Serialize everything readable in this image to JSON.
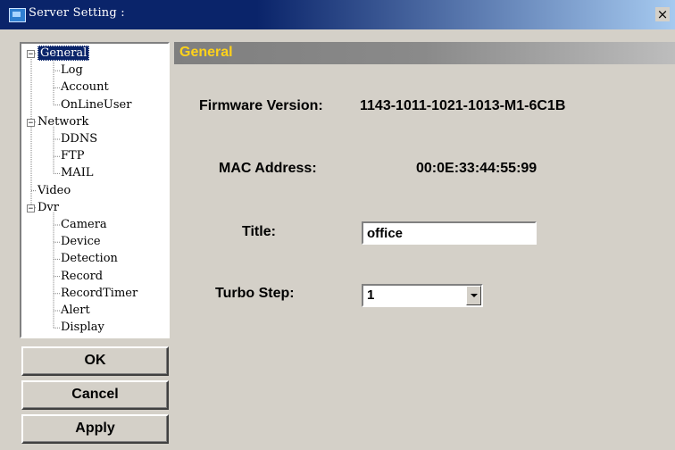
{
  "window": {
    "title": "Server Setting :",
    "close_glyph": "×"
  },
  "tree": {
    "items": [
      {
        "label": "General",
        "expander": "−",
        "level": 0,
        "selected": true
      },
      {
        "label": "Log",
        "level": 1
      },
      {
        "label": "Account",
        "level": 1
      },
      {
        "label": "OnLineUser",
        "level": 1
      },
      {
        "label": "Network",
        "expander": "−",
        "level": 0
      },
      {
        "label": "DDNS",
        "level": 1
      },
      {
        "label": "FTP",
        "level": 1
      },
      {
        "label": "MAIL",
        "level": 1
      },
      {
        "label": "Video",
        "level": 0
      },
      {
        "label": "Dvr",
        "expander": "−",
        "level": 0
      },
      {
        "label": "Camera",
        "level": 1
      },
      {
        "label": "Device",
        "level": 1
      },
      {
        "label": "Detection",
        "level": 1
      },
      {
        "label": "Record",
        "level": 1
      },
      {
        "label": "RecordTimer",
        "level": 1
      },
      {
        "label": "Alert",
        "level": 1
      },
      {
        "label": "Display",
        "level": 1
      }
    ]
  },
  "buttons": {
    "ok": "OK",
    "cancel": "Cancel",
    "apply": "Apply"
  },
  "content": {
    "header": "General",
    "firmware_label": "Firmware Version:",
    "firmware_value": "1143-1011-1021-1013-M1-6C1B",
    "mac_label": "MAC Address:",
    "mac_value": "00:0E:33:44:55:99",
    "title_label": "Title:",
    "title_value": "office",
    "turbo_label": "Turbo Step:",
    "turbo_value": "1"
  },
  "colors": {
    "titlebar_start": "#0a246a",
    "titlebar_end": "#a6caf0",
    "header_text": "#ffd21a",
    "face": "#d4d0c8",
    "selection": "#0a246a"
  },
  "icons": {
    "app": "app-window-icon",
    "close": "close-icon",
    "expand": "minus-box-icon",
    "dropdown": "chevron-down-icon"
  }
}
